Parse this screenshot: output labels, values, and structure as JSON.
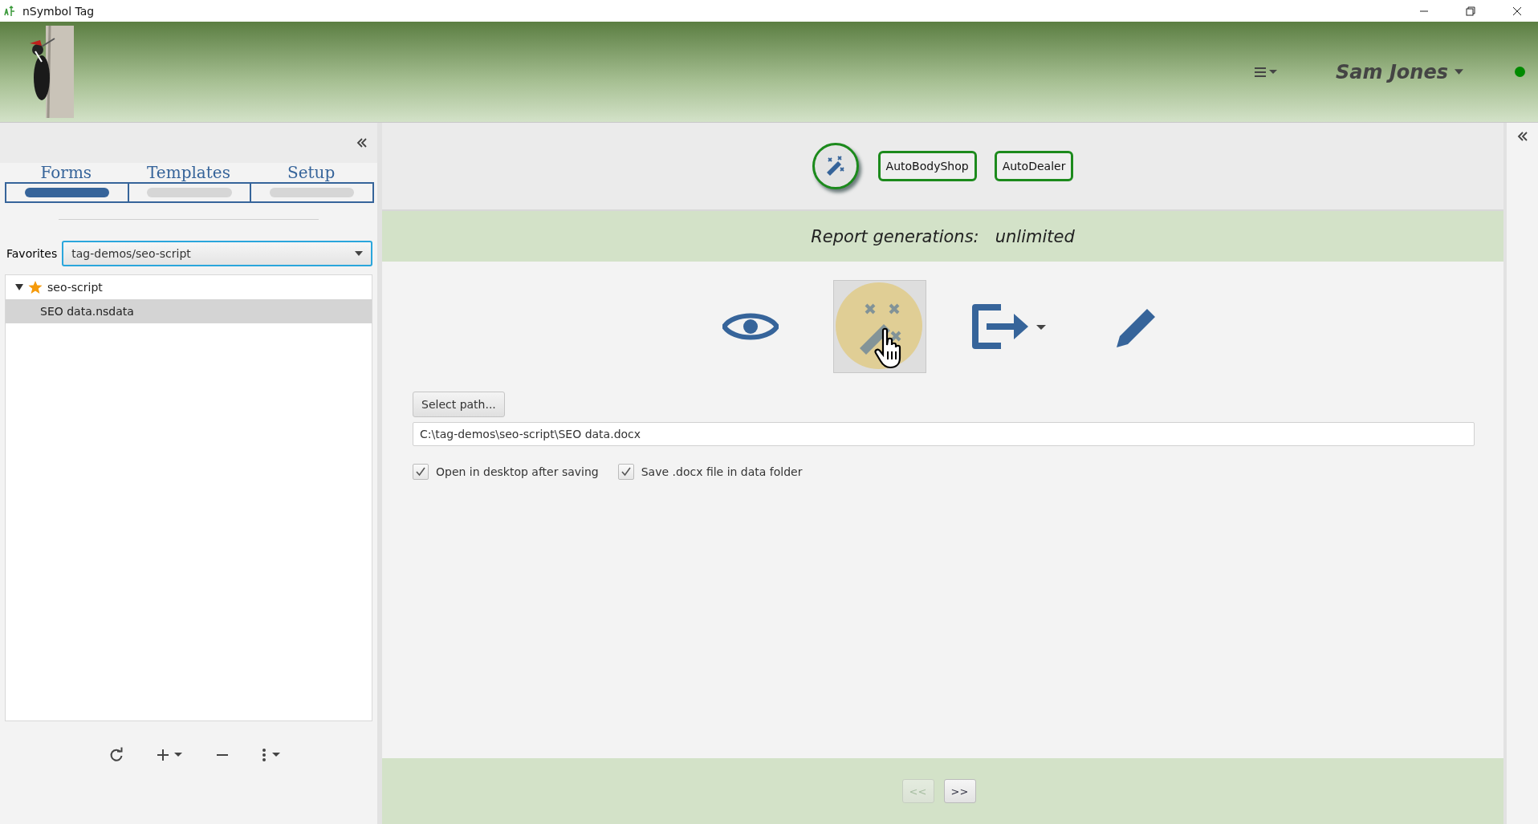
{
  "window": {
    "title": "nSymbol Tag"
  },
  "header": {
    "user": "Sam Jones",
    "online": true
  },
  "sidebar": {
    "tabs": [
      {
        "label": "Forms",
        "selected": true
      },
      {
        "label": "Templates",
        "selected": false
      },
      {
        "label": "Setup",
        "selected": false
      }
    ],
    "favorites": {
      "label": "Favorites",
      "value": "tag-demos/seo-script"
    },
    "tree": [
      {
        "label": "seo-script",
        "starred": true,
        "expanded": true,
        "selected": false,
        "children": [
          {
            "label": "SEO data.nsdata",
            "selected": true
          }
        ]
      }
    ]
  },
  "toolbar": {
    "templates": [
      {
        "label": "AutoBodyShop"
      },
      {
        "label": "AutoDealer"
      }
    ]
  },
  "banner": {
    "label": "Report generations:",
    "value": "unlimited"
  },
  "actions": [
    {
      "kind": "preview",
      "selected": false
    },
    {
      "kind": "generate",
      "selected": true
    },
    {
      "kind": "export",
      "selected": false
    },
    {
      "kind": "edit",
      "selected": false
    }
  ],
  "output": {
    "button": "Select path...",
    "path": "C:\\tag-demos\\seo-script\\SEO data.docx",
    "options": [
      {
        "label": "Open in desktop after saving",
        "checked": true
      },
      {
        "label": "Save .docx file in data folder",
        "checked": true
      }
    ]
  },
  "pager": [
    {
      "label": "<<",
      "disabled": true
    },
    {
      "label": ">>",
      "disabled": false
    }
  ]
}
